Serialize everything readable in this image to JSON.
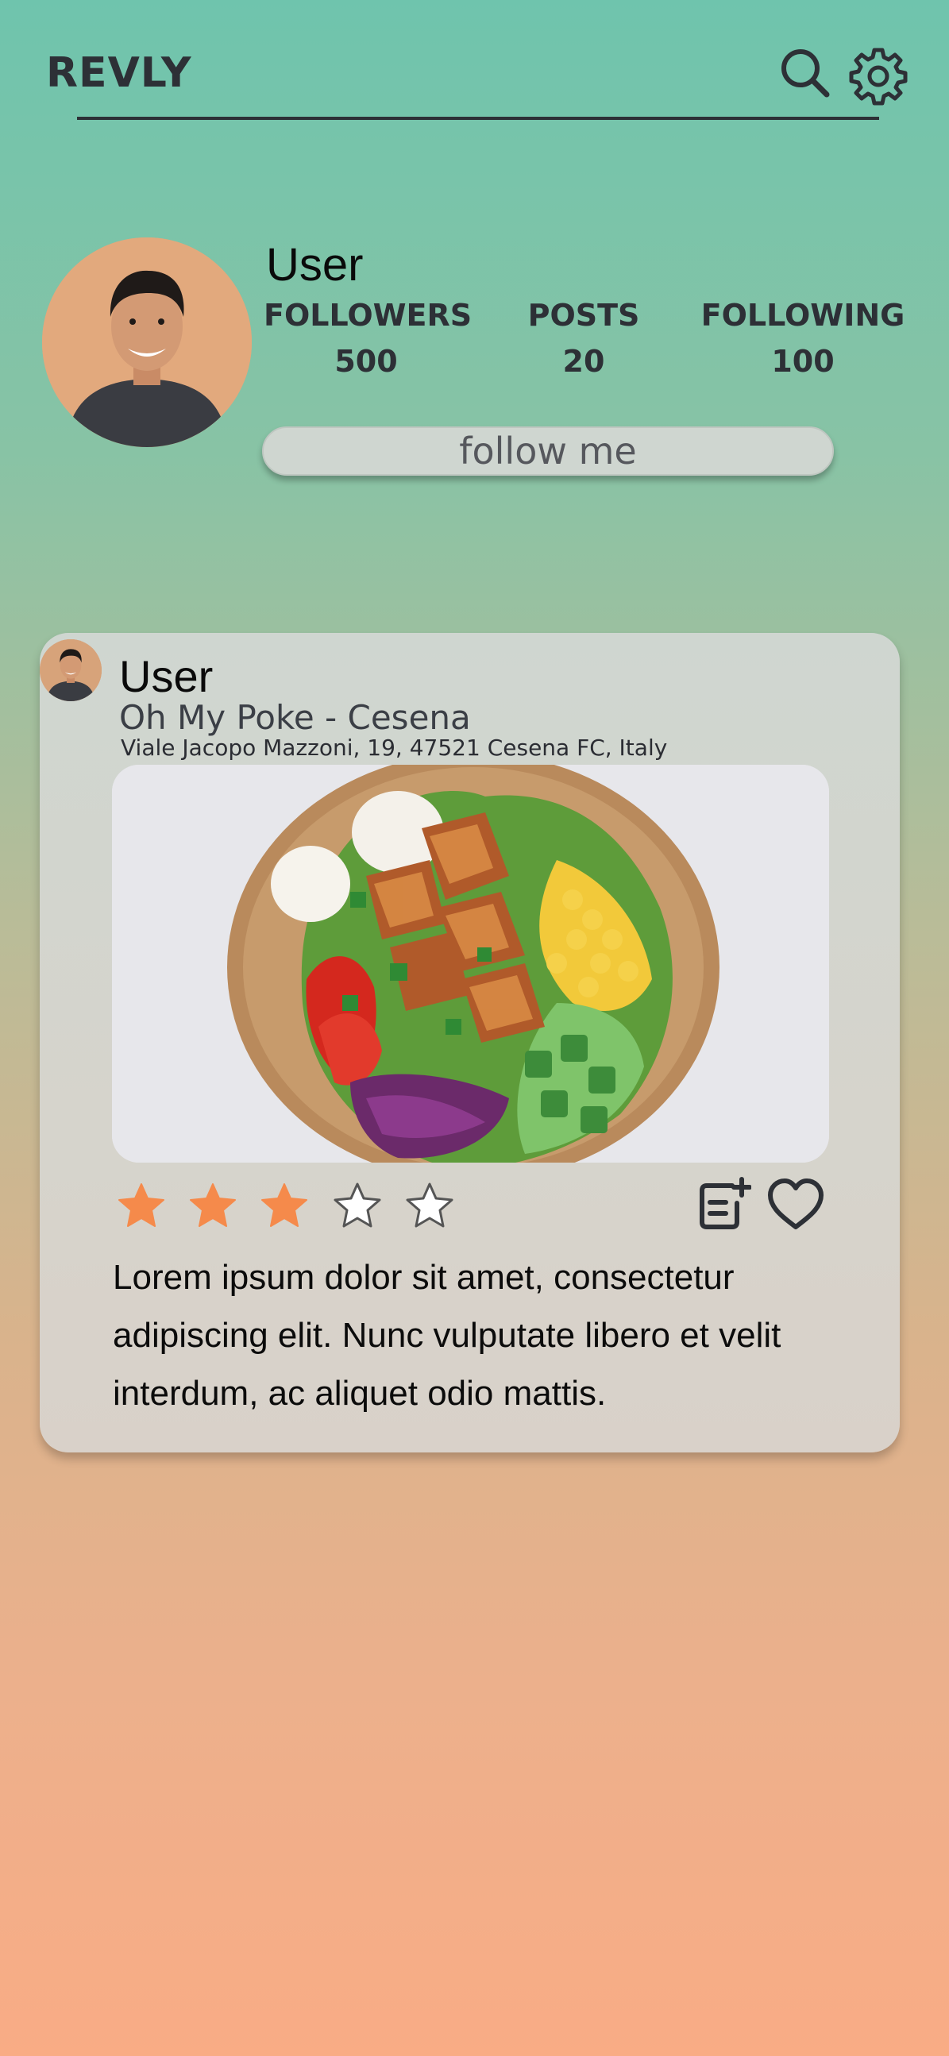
{
  "app": {
    "title": "REVLY"
  },
  "header": {
    "search_icon": "search-icon",
    "settings_icon": "gear-icon"
  },
  "profile": {
    "username": "User",
    "stats": [
      {
        "label": "FOLLOWERS",
        "value": "500"
      },
      {
        "label": "POSTS",
        "value": "20"
      },
      {
        "label": "FOLLOWING",
        "value": "100"
      }
    ],
    "follow_label": "follow me"
  },
  "post": {
    "username": "User",
    "place": "Oh My Poke - Cesena",
    "address": "Viale Jacopo Mazzoni, 19, 47521 Cesena FC, Italy",
    "rating": 3,
    "rating_max": 5,
    "text": "Lorem ipsum dolor sit amet, consectetur adipiscing elit. Nunc vulputate libero et velit interdum, ac aliquet odio mattis."
  },
  "colors": {
    "star_filled": "#f58a4b",
    "star_empty": "#ffffff",
    "text_dark": "#2d3036",
    "card_bg": "#d3d5ce"
  }
}
